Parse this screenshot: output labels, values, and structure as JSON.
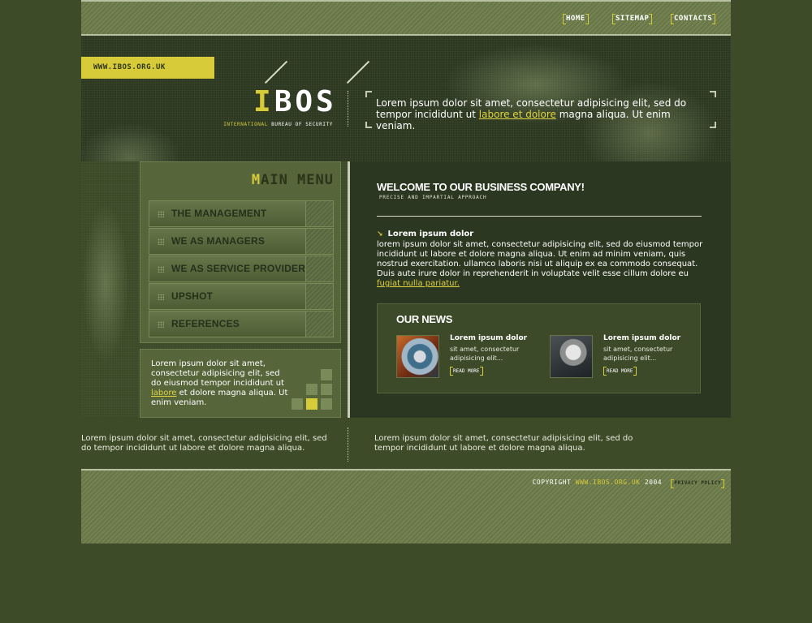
{
  "nav": {
    "home": "HOME",
    "sitemap": "SITEMAP",
    "contacts": "CONTACTS"
  },
  "header": {
    "url_tag": "WWW.IBOS.ORG.UK",
    "logo_accent": "I",
    "logo_rest": "BOS",
    "logo_sub_accent": "INTERNATIONAL",
    "logo_sub_rest": "BUREAU OF SECURITY",
    "quote_before": "Lorem ipsum dolor sit amet, consectetur adipisicing elit, sed do tempor incididunt ut",
    "quote_link": "labore et dolore",
    "quote_after": "magna aliqua. Ut enim veniam."
  },
  "menu": {
    "title_accent": "M",
    "title_rest": "AIN MENU",
    "items": [
      {
        "label": "THE MANAGEMENT"
      },
      {
        "label": "WE AS MANAGERS"
      },
      {
        "label": "WE AS SERVICE PROVIDER"
      },
      {
        "label": "UPSHOT"
      },
      {
        "label": "REFERENCES"
      }
    ]
  },
  "left_note": {
    "text_before": "Lorem ipsum dolor sit amet, consectetur adipisicing elit, sed do eiusmod tempor incididunt ut",
    "link": "labore",
    "text_after": "et dolore magna aliqua. Ut enim veniam."
  },
  "welcome": {
    "title": "WELCOME TO OUR BUSINESS COMPANY!",
    "subtitle": "PRECISE AND IMPARTIAL APPROACH",
    "lead_heading": "Lorem ipsum dolor",
    "lead_body": "lorem ipsum dolor sit amet, consectetur adipisicing elit, sed do eiusmod tempor incididunt ut labore et dolore magna aliqua. Ut enim ad minim veniam, quis nostrud exercitation. ullamco laboris nisi ut aliquip ex ea commodo consequat. Duis aute irure dolor in reprehenderit in voluptate velit esse cillum dolore eu",
    "lead_link": "fugiat nulla pariatur."
  },
  "news": {
    "title": "OUR NEWS",
    "items": [
      {
        "heading": "Lorem ipsum dolor",
        "text": "sit amet, consectetur adipisicing elit...",
        "read_more": "READ MORE"
      },
      {
        "heading": "Lorem ipsum dolor",
        "text": "sit amet, consectetur adipisicing elit...",
        "read_more": "READ MORE"
      }
    ]
  },
  "bottom": {
    "left_text": "Lorem ipsum dolor sit amet, consectetur adipisicing elit, sed do tempor incididunt ut labore et dolore magna aliqua.",
    "right_text": "Lorem ipsum dolor sit amet, consectetur adipisicing elit, sed do tempor incididunt ut labore et dolore magna aliqua."
  },
  "footer": {
    "copyright_label": "COPYRIGHT",
    "site": "WWW.IBOS.ORG.UK",
    "year": "2004",
    "privacy": "PRIVACY POLICY"
  },
  "colors": {
    "background": "#3d4b28",
    "accent_yellow": "#d8cb3a",
    "panel_green": "#56653a",
    "dark_panel": "#2b3720"
  },
  "icons": [
    "bracket-icon",
    "arrow-bullet-icon",
    "grid-dots-icon"
  ]
}
